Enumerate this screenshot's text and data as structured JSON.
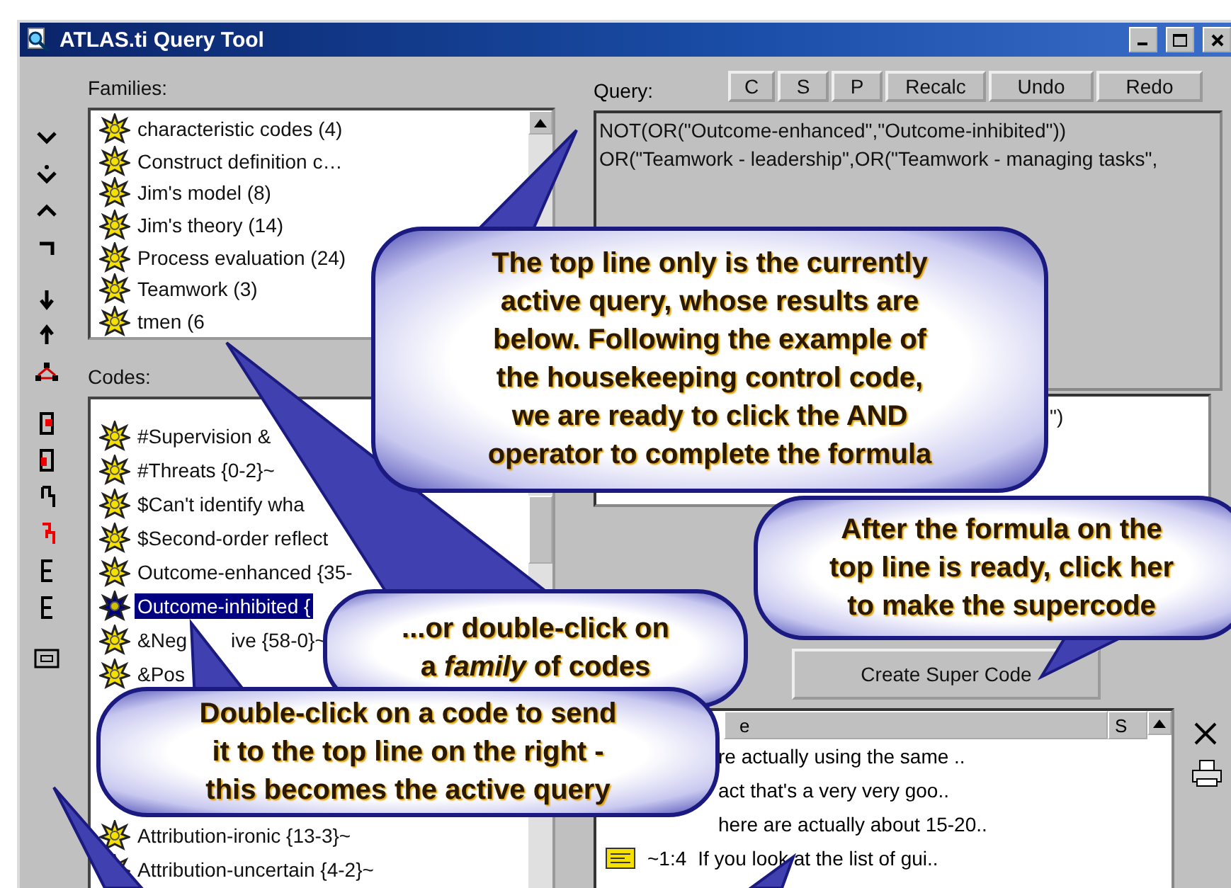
{
  "window": {
    "title": "ATLAS.ti Query Tool"
  },
  "families": {
    "label": "Families:",
    "items": [
      {
        "label": "characteristic codes (4)"
      },
      {
        "label": "Construct definition c…"
      },
      {
        "label": "Jim's model (8)"
      },
      {
        "label": "Jim's theory (14)"
      },
      {
        "label": "Process evaluation (24)"
      },
      {
        "label": "Teamwork (3)"
      },
      {
        "label": "tmen (6"
      }
    ]
  },
  "codes": {
    "label": "Codes:",
    "items_top": [
      {
        "label": "#Supervision &",
        "selected": false
      },
      {
        "label": "#Threats {0-2}~",
        "selected": false
      },
      {
        "label": "$Can't identify wha",
        "selected": false
      },
      {
        "label": "$Second-order reflect",
        "selected": false
      },
      {
        "label": "Outcome-enhanced {35-",
        "selected": false
      },
      {
        "label": "Outcome-inhibited {",
        "selected": true
      },
      {
        "label": "&Neg",
        "label_after": "ive {58-0}~",
        "selected": false
      },
      {
        "label": "&Pos",
        "selected": false
      }
    ],
    "items_bottom": [
      {
        "label": "Attribution-ironic {13-3}~",
        "selected": false
      },
      {
        "label": "Attribution-uncertain {4-2}~",
        "selected": false
      }
    ]
  },
  "query": {
    "label": "Query:",
    "buttons": [
      "C",
      "S",
      "P",
      "Recalc",
      "Undo",
      "Redo"
    ],
    "lines": [
      "NOT(OR(\"Outcome-enhanced\",\"Outcome-inhibited\"))",
      "OR(\"Teamwork - leadership\",OR(\"Teamwork - managing tasks\","
    ],
    "stack_lines": [
      "\")"
    ]
  },
  "create_button": "Create Super Code",
  "results": {
    "columns": [
      "e",
      "S"
    ],
    "rows": [
      {
        "text": "re actually using the same .."
      },
      {
        "text": "act that's a very very goo.."
      },
      {
        "text": "here are actually about 15-20.."
      },
      {
        "ref": "~1:4",
        "text": "If you look at the list of gui.."
      }
    ]
  },
  "callouts": [
    {
      "lines": [
        "The top line only is the currently",
        "active query, whose results are",
        "below. Following the example of",
        "the housekeeping control code,",
        "we are ready to click the AND",
        "operator to complete the formula"
      ]
    },
    {
      "lines": [
        "...or double-click on",
        "a *family* of codes"
      ]
    },
    {
      "lines": [
        "Double-click on a code to send",
        "it to the top line on the right -",
        "this becomes the active query"
      ]
    },
    {
      "lines": [
        "After the formula on the",
        "top line is ready, click her",
        "to make the supercode"
      ]
    }
  ]
}
